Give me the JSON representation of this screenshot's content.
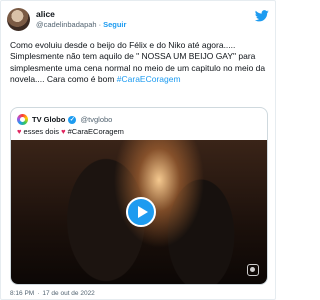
{
  "tweet": {
    "author_name": "alice",
    "author_handle": "@cadelinbadapah",
    "separator": "·",
    "follow_label": "Seguir",
    "text": "Como evoluiu desde o beijo do Félix e do Niko até agora..... Simplesmente não tem aquilo de \" NOSSA UM BEIJO GAY\"  para simplesmente uma cena normal no meio de um capitulo no meio da novela.... Cara como é bom ",
    "hashtag": "#CaraECoragem",
    "time": "8:16 PM",
    "date": "17 de out de 2022"
  },
  "quote": {
    "name": "TV Globo",
    "handle": "@tvglobo",
    "text_prefix": "esses dois",
    "text_hashtag": "#CaraECoragem"
  },
  "icons": {
    "twitter": "twitter-bird-icon",
    "verified": "verified-badge-icon",
    "play": "play-icon",
    "heart": "heart-icon",
    "watermark": "globo-watermark-icon"
  },
  "colors": {
    "accent": "#1d9bf0",
    "text": "#0f1419",
    "muted": "#536471",
    "heart": "#e0245e"
  }
}
